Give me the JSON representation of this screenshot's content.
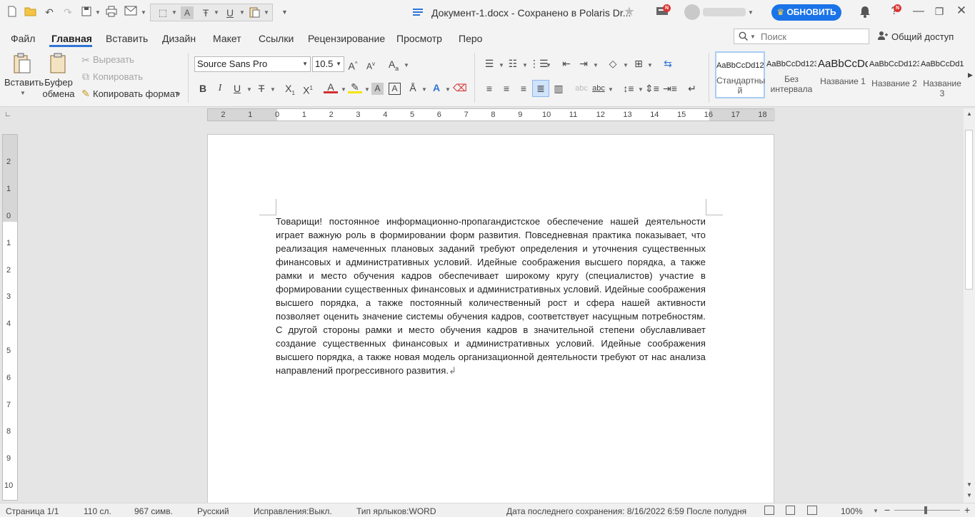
{
  "titlebar": {
    "doc_title": "Документ-1.docx - Сохранено в Polaris Dr...",
    "update_label": "ОБНОВИТЬ",
    "badge_n": "N",
    "icons": [
      "new-folder-icon",
      "open-icon",
      "undo-icon",
      "redo-icon",
      "save-icon",
      "print-icon",
      "email-icon",
      "border-icon",
      "font-format-icon",
      "strikethrough-icon",
      "underline-icon",
      "paste-icon",
      "customize-icon",
      "list-icon",
      "star-icon",
      "messages-icon",
      "user-avatar",
      "notifications-icon",
      "help-icon",
      "restore-icon",
      "close-icon"
    ]
  },
  "menu": {
    "tabs": [
      "Файл",
      "Главная",
      "Вставить",
      "Дизайн",
      "Макет",
      "Ссылки",
      "Рецензирование",
      "Просмотр",
      "Перо"
    ],
    "active_tab": "Главная",
    "search_placeholder": "Поиск",
    "share_label": "Общий доступ"
  },
  "ribbon": {
    "paste_label": "Вставить",
    "clipboard_label_1": "Буфер",
    "clipboard_label_2": "обмена",
    "cut_label": "Вырезать",
    "copy_label": "Копировать",
    "format_painter_label": "Копировать формат",
    "font_name": "Source Sans Pro",
    "font_size": "10.5",
    "styles": [
      {
        "preview": "AaBbCcDd123",
        "name_1": "Стандартны",
        "name_2": "й"
      },
      {
        "preview": "AaBbCcDd123",
        "name_1": "Без",
        "name_2": "интервала"
      },
      {
        "preview": "AaBbCcDd",
        "name_1": "Название 1",
        "name_2": ""
      },
      {
        "preview": "AaBbCcDd123",
        "name_1": "Название 2",
        "name_2": ""
      },
      {
        "preview": "AaBbCcDd123",
        "name_1": "Название 3",
        "name_2": ""
      }
    ]
  },
  "ruler": {
    "h_ticks": [
      "2",
      "1",
      "0",
      "1",
      "2",
      "3",
      "4",
      "5",
      "6",
      "7",
      "8",
      "9",
      "10",
      "11",
      "12",
      "13",
      "14",
      "15",
      "16",
      "17",
      "18"
    ],
    "v_ticks": [
      "2",
      "1",
      "0",
      "1",
      "2",
      "3",
      "4",
      "5",
      "6",
      "7",
      "8",
      "9",
      "10"
    ]
  },
  "document": {
    "body": "Товарищи! постоянное информационно-пропагандистское обеспечение нашей деятельности играет важную роль в формировании форм развития. Повседневная практика показывает, что реализация намеченных плановых заданий требуют определения и уточнения существенных финансовых и административных условий. Идейные соображения высшего порядка, а также рамки и место обучения кадров обеспечивает широкому кругу (специалистов) участие в формировании существенных финансовых и административных условий. Идейные соображения высшего порядка, а также постоянный количественный рост и сфера нашей активности позволяет оценить значение системы обучения кадров, соответствует насущным потребностям. С другой стороны рамки и место обучения кадров в значительной степени обуславливает создание существенных финансовых и административных условий. Идейные соображения высшего порядка, а также новая модель организационной деятельности требуют от нас анализа направлений прогрессивного развития.",
    "para_mark": "↲"
  },
  "status": {
    "page": "Страница 1/1",
    "words": "110 сл.",
    "chars": "967 симв.",
    "language": "Русский",
    "track_changes": "Исправления:Выкл.",
    "label_type": "Тип ярлыков:WORD",
    "last_saved": "Дата последнего сохранения: 8/16/2022 6:59 После полудня",
    "zoom": "100%",
    "zoom_level_percent": 100
  },
  "colors": {
    "accent": "#2e75d6",
    "update_button": "#1a73e8",
    "font_color": "#d32f2f",
    "highlight": "#f5e400"
  }
}
